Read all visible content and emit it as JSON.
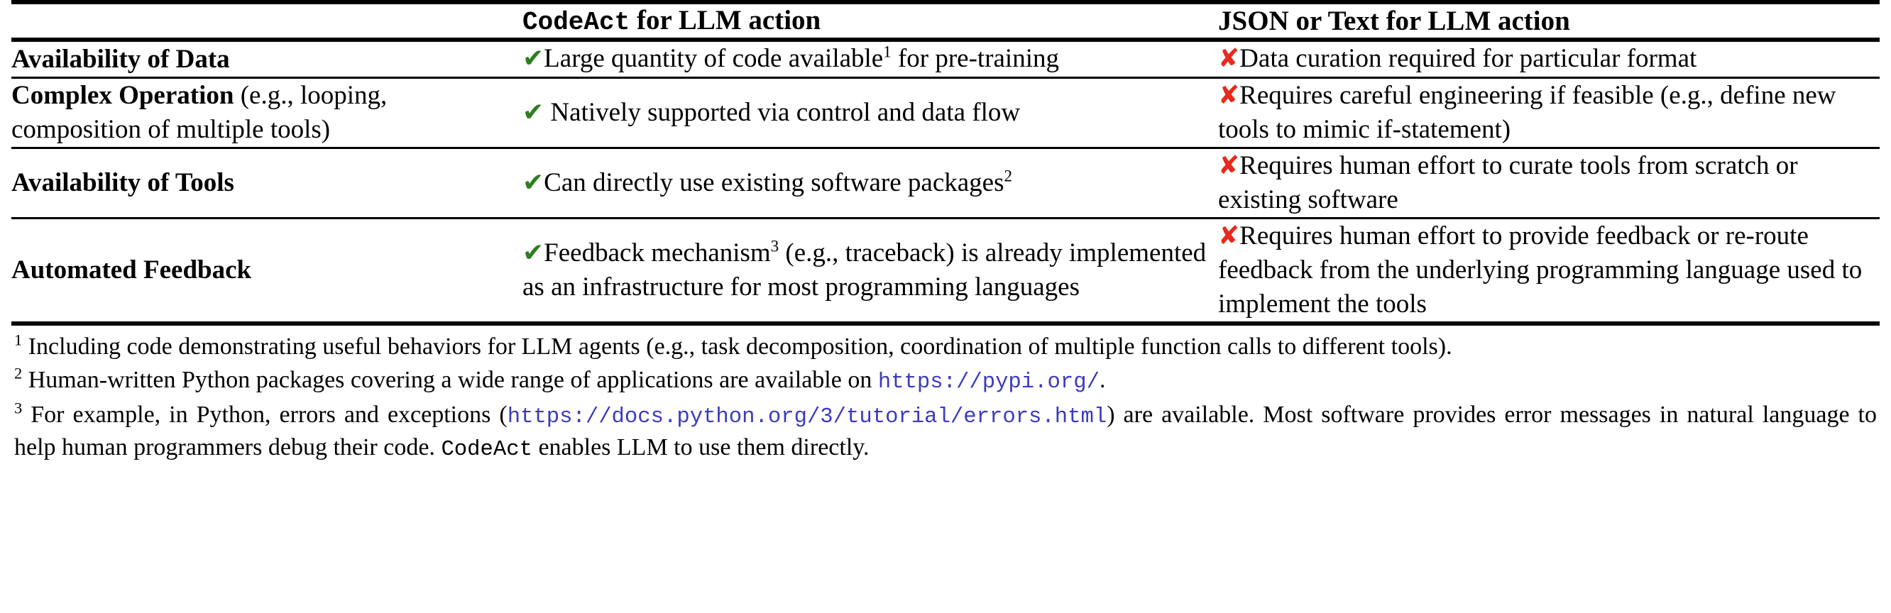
{
  "table": {
    "header": {
      "attribute_col_label": "",
      "col2_mono": "CodeAct",
      "col2_rest": " for LLM action",
      "col3": "JSON or Text for LLM action"
    },
    "check_glyph": "✔",
    "cross_glyph": "✘",
    "colors": {
      "check": "#2e7d22",
      "cross": "#e8291c",
      "url": "#3b3bbf",
      "rule": "#000000"
    },
    "rows": [
      {
        "attribute_bold": "Availability of Data",
        "attribute_note": "",
        "codeact_pre": "Large quantity of code available",
        "codeact_sup": "1",
        "codeact_post": " for pre-training",
        "json_text": "Data curation required for particular format"
      },
      {
        "attribute_bold": "Complex Operation",
        "attribute_note": " (e.g., looping, composition of multiple tools)",
        "codeact_pre": "Natively supported via control and data flow",
        "codeact_sup": "",
        "codeact_post": "",
        "json_text": "Requires careful engineering if feasible (e.g., define new tools to mimic if-statement)"
      },
      {
        "attribute_bold": "Availability of Tools",
        "attribute_note": "",
        "codeact_pre": "Can directly use existing software packages",
        "codeact_sup": "2",
        "codeact_post": "",
        "json_text": "Requires human effort to curate tools from scratch or existing software"
      },
      {
        "attribute_bold": "Automated Feedback",
        "attribute_note": "",
        "codeact_pre": "Feedback mechanism",
        "codeact_sup": "3",
        "codeact_post": " (e.g., traceback) is already implemented as an infrastructure for most programming languages",
        "json_text": "Requires human effort to provide feedback or re-route feedback from the underlying programming language used to implement the tools"
      }
    ]
  },
  "footnotes": [
    {
      "marker": "1",
      "text": "Including code demonstrating useful behaviors for LLM agents (e.g., task decomposition, coordination of multiple function calls to different tools)."
    },
    {
      "marker": "2",
      "pre": "Human-written Python packages covering a wide range of applications are available on ",
      "url": "https://pypi.org/",
      "post": "."
    },
    {
      "marker": "3",
      "pre": "For example, in Python, errors and exceptions (",
      "url": "https://docs.python.org/3/tutorial/errors.html",
      "mid": ") are available. Most software provides error messages in natural language to help human programmers debug their code. ",
      "mono": "CodeAct",
      "post": " enables LLM to use them directly."
    }
  ]
}
